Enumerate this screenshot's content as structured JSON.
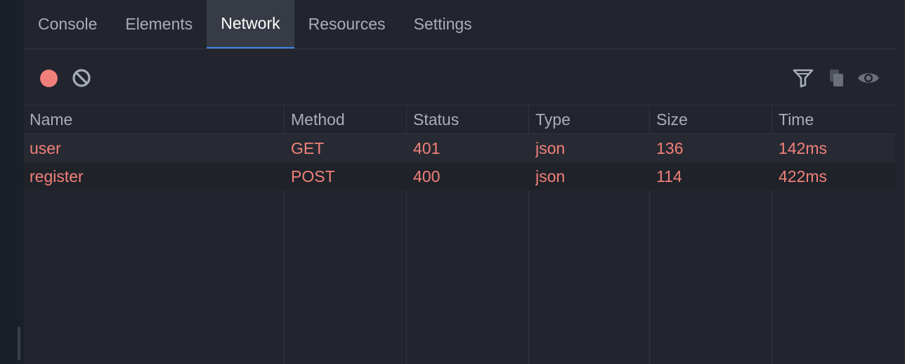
{
  "tabs": [
    {
      "label": "Console"
    },
    {
      "label": "Elements"
    },
    {
      "label": "Network"
    },
    {
      "label": "Resources"
    },
    {
      "label": "Settings"
    }
  ],
  "active_tab": "Network",
  "toolbar": {
    "left_icons": [
      "record-icon",
      "clear-icon"
    ],
    "right_icons": [
      "filter-icon",
      "copy-icon",
      "eye-icon"
    ]
  },
  "table": {
    "columns": [
      "Name",
      "Method",
      "Status",
      "Type",
      "Size",
      "Time"
    ],
    "rows": [
      {
        "name": "user",
        "method": "GET",
        "status": "401",
        "type": "json",
        "size": "136",
        "time": "142ms"
      },
      {
        "name": "register",
        "method": "POST",
        "status": "400",
        "type": "json",
        "size": "114",
        "time": "422ms"
      }
    ]
  },
  "colors": {
    "accent": "#3f86e8",
    "error_text": "#f2807a",
    "panel_bg": "#22252d",
    "header_text": "#a7adb9"
  }
}
